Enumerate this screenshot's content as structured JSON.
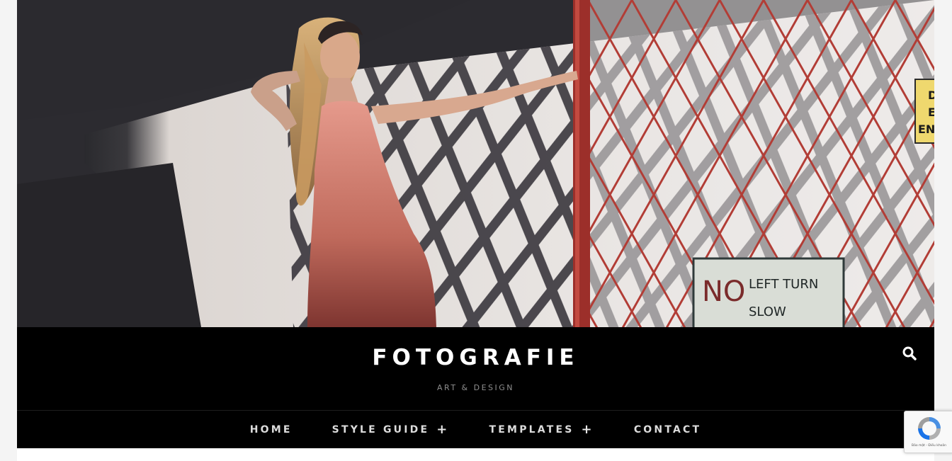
{
  "site": {
    "title": "FOTOGRAFIE",
    "tagline": "ART & DESIGN"
  },
  "hero": {
    "image_alt": "Woman in a pink dress standing in sunlight beside a red lattice fence",
    "sign_main": {
      "line1_left": "NO",
      "line1_right": "LEFT TURN",
      "line2": "SLOW"
    },
    "sign_edge": {
      "line1": "D",
      "line2": "E",
      "line3": "EN"
    }
  },
  "search": {
    "icon": "search-icon"
  },
  "nav": {
    "items": [
      {
        "label": "HOME",
        "has_submenu": false
      },
      {
        "label": "STYLE GUIDE",
        "has_submenu": true
      },
      {
        "label": "TEMPLATES",
        "has_submenu": true
      },
      {
        "label": "CONTACT",
        "has_submenu": false
      }
    ],
    "submenu_icon": "+"
  },
  "recaptcha": {
    "links": "Bảo mật - Điều khoản"
  },
  "colors": {
    "header_bg": "#000000",
    "title": "#ffffff",
    "tagline": "#8f8f8f",
    "nav_text": "#dcdcdc",
    "fence": "#b8413a",
    "dress": "#c9786d"
  }
}
